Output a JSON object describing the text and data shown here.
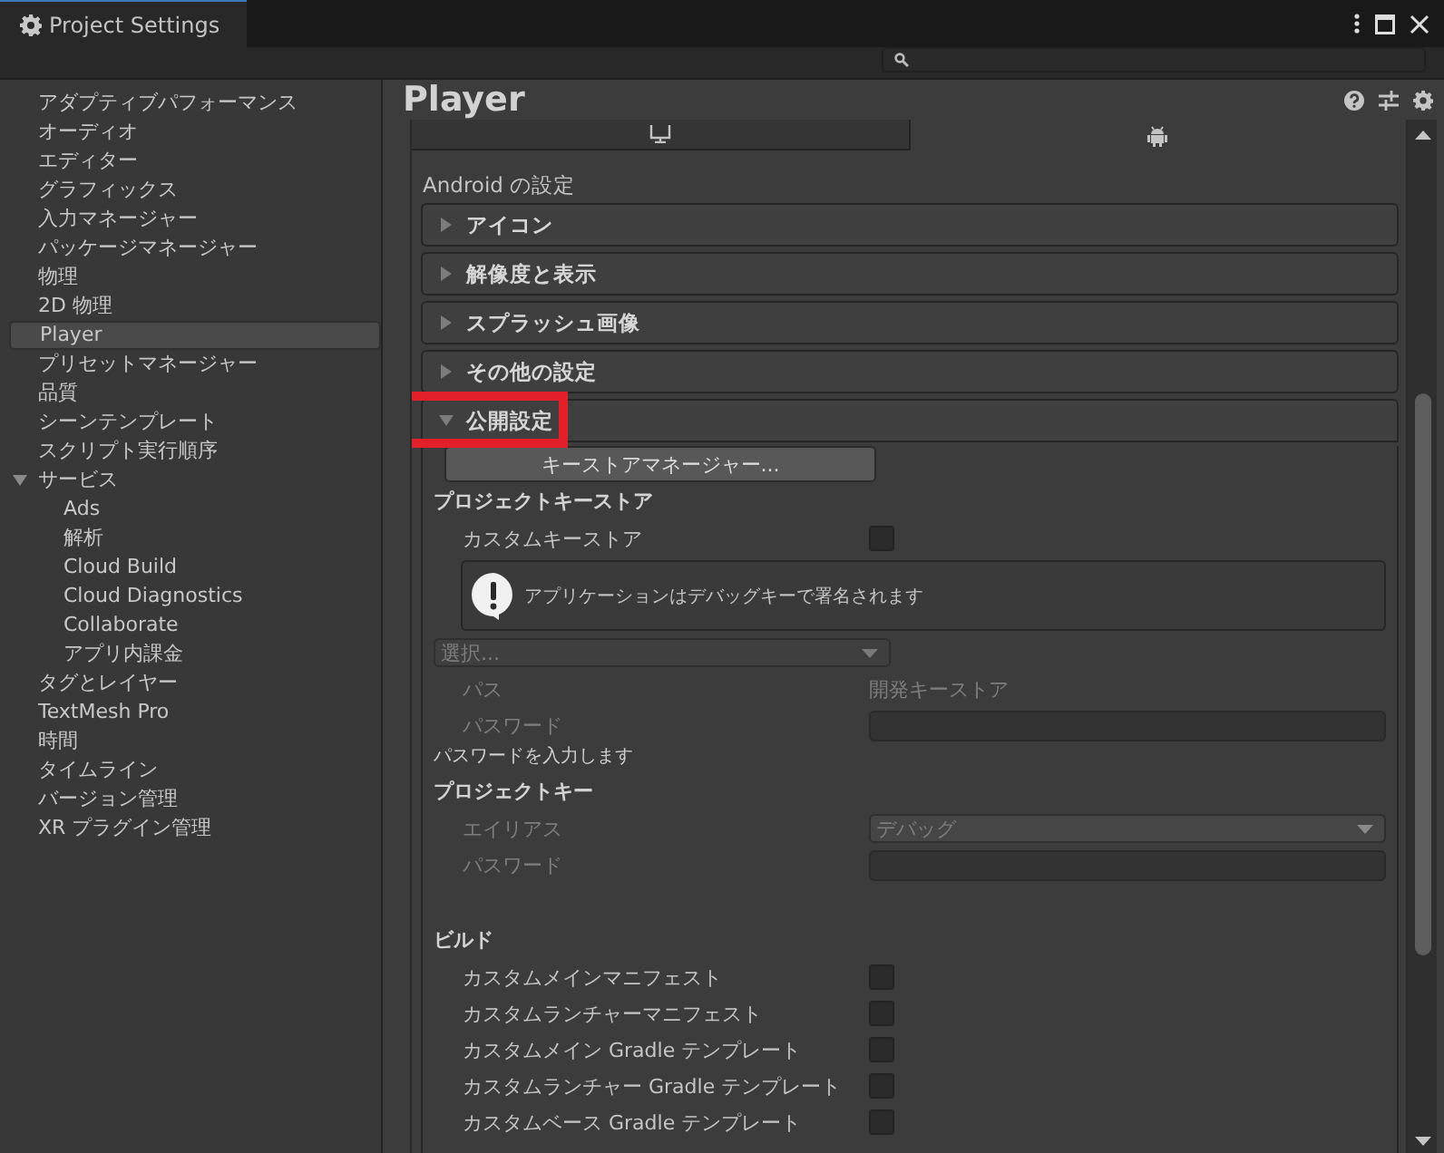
{
  "window": {
    "title": "Project Settings"
  },
  "sidebar": {
    "items": [
      {
        "label": "アダプティブパフォーマンス",
        "selected": false
      },
      {
        "label": "オーディオ",
        "selected": false
      },
      {
        "label": "エディター",
        "selected": false
      },
      {
        "label": "グラフィックス",
        "selected": false
      },
      {
        "label": "入力マネージャー",
        "selected": false
      },
      {
        "label": "パッケージマネージャー",
        "selected": false
      },
      {
        "label": "物理",
        "selected": false
      },
      {
        "label": "2D 物理",
        "selected": false
      },
      {
        "label": "Player",
        "selected": true
      },
      {
        "label": "プリセットマネージャー",
        "selected": false
      },
      {
        "label": "品質",
        "selected": false
      },
      {
        "label": "シーンテンプレート",
        "selected": false
      },
      {
        "label": "スクリプト実行順序",
        "selected": false
      },
      {
        "label": "サービス",
        "selected": false,
        "expanded": true,
        "children": [
          {
            "label": "Ads",
            "selected": false
          },
          {
            "label": "解析",
            "selected": false
          },
          {
            "label": "Cloud Build",
            "selected": false
          },
          {
            "label": "Cloud Diagnostics",
            "selected": false
          },
          {
            "label": "Collaborate",
            "selected": false
          },
          {
            "label": "アプリ内課金",
            "selected": false
          }
        ]
      },
      {
        "label": "タグとレイヤー",
        "selected": false
      },
      {
        "label": "TextMesh Pro",
        "selected": false
      },
      {
        "label": "時間",
        "selected": false
      },
      {
        "label": "タイムライン",
        "selected": false
      },
      {
        "label": "バージョン管理",
        "selected": false
      },
      {
        "label": "XR プラグイン管理",
        "selected": false
      }
    ]
  },
  "panel": {
    "title": "Player",
    "platform_tabs": [
      {
        "kind": "desktop",
        "selected": false
      },
      {
        "kind": "android",
        "selected": true
      }
    ],
    "section_title": "Android の設定",
    "foldouts": [
      {
        "label": "アイコン",
        "expanded": false,
        "highlighted": false
      },
      {
        "label": "解像度と表示",
        "expanded": false,
        "highlighted": false
      },
      {
        "label": "スプラッシュ画像",
        "expanded": false,
        "highlighted": false
      },
      {
        "label": "その他の設定",
        "expanded": false,
        "highlighted": false
      },
      {
        "label": "公開設定",
        "expanded": true,
        "highlighted": true,
        "rows": [
          {
            "kind": "button",
            "label": "キーストアマネージャー..."
          },
          {
            "kind": "heading",
            "label": "プロジェクトキーストア"
          },
          {
            "kind": "checkbox",
            "label": "カスタムキーストア",
            "checked": false
          },
          {
            "kind": "warning",
            "text": "アプリケーションはデバッグキーで署名されます"
          },
          {
            "kind": "select",
            "value": "選択...",
            "disabled": true
          },
          {
            "kind": "text",
            "label": "パス",
            "value": "開発キーストア",
            "disabled": true
          },
          {
            "kind": "field",
            "label": "パスワード",
            "disabled": true
          },
          {
            "kind": "note",
            "text": "パスワードを入力します"
          },
          {
            "kind": "heading",
            "label": "プロジェクトキー"
          },
          {
            "kind": "select",
            "label": "エイリアス",
            "value": "デバッグ",
            "disabled": true
          },
          {
            "kind": "field",
            "label": "パスワード",
            "disabled": true
          },
          {
            "kind": "spacer"
          },
          {
            "kind": "heading",
            "label": "ビルド"
          },
          {
            "kind": "checkbox",
            "label": "カスタムメインマニフェスト",
            "checked": false
          },
          {
            "kind": "checkbox",
            "label": "カスタムランチャーマニフェスト",
            "checked": false
          },
          {
            "kind": "checkbox",
            "label": "カスタムメイン Gradle テンプレート",
            "checked": false
          },
          {
            "kind": "checkbox",
            "label": "カスタムランチャー Gradle テンプレート",
            "checked": false
          },
          {
            "kind": "checkbox",
            "label": "カスタムベース Gradle テンプレート",
            "checked": false
          }
        ]
      }
    ]
  }
}
